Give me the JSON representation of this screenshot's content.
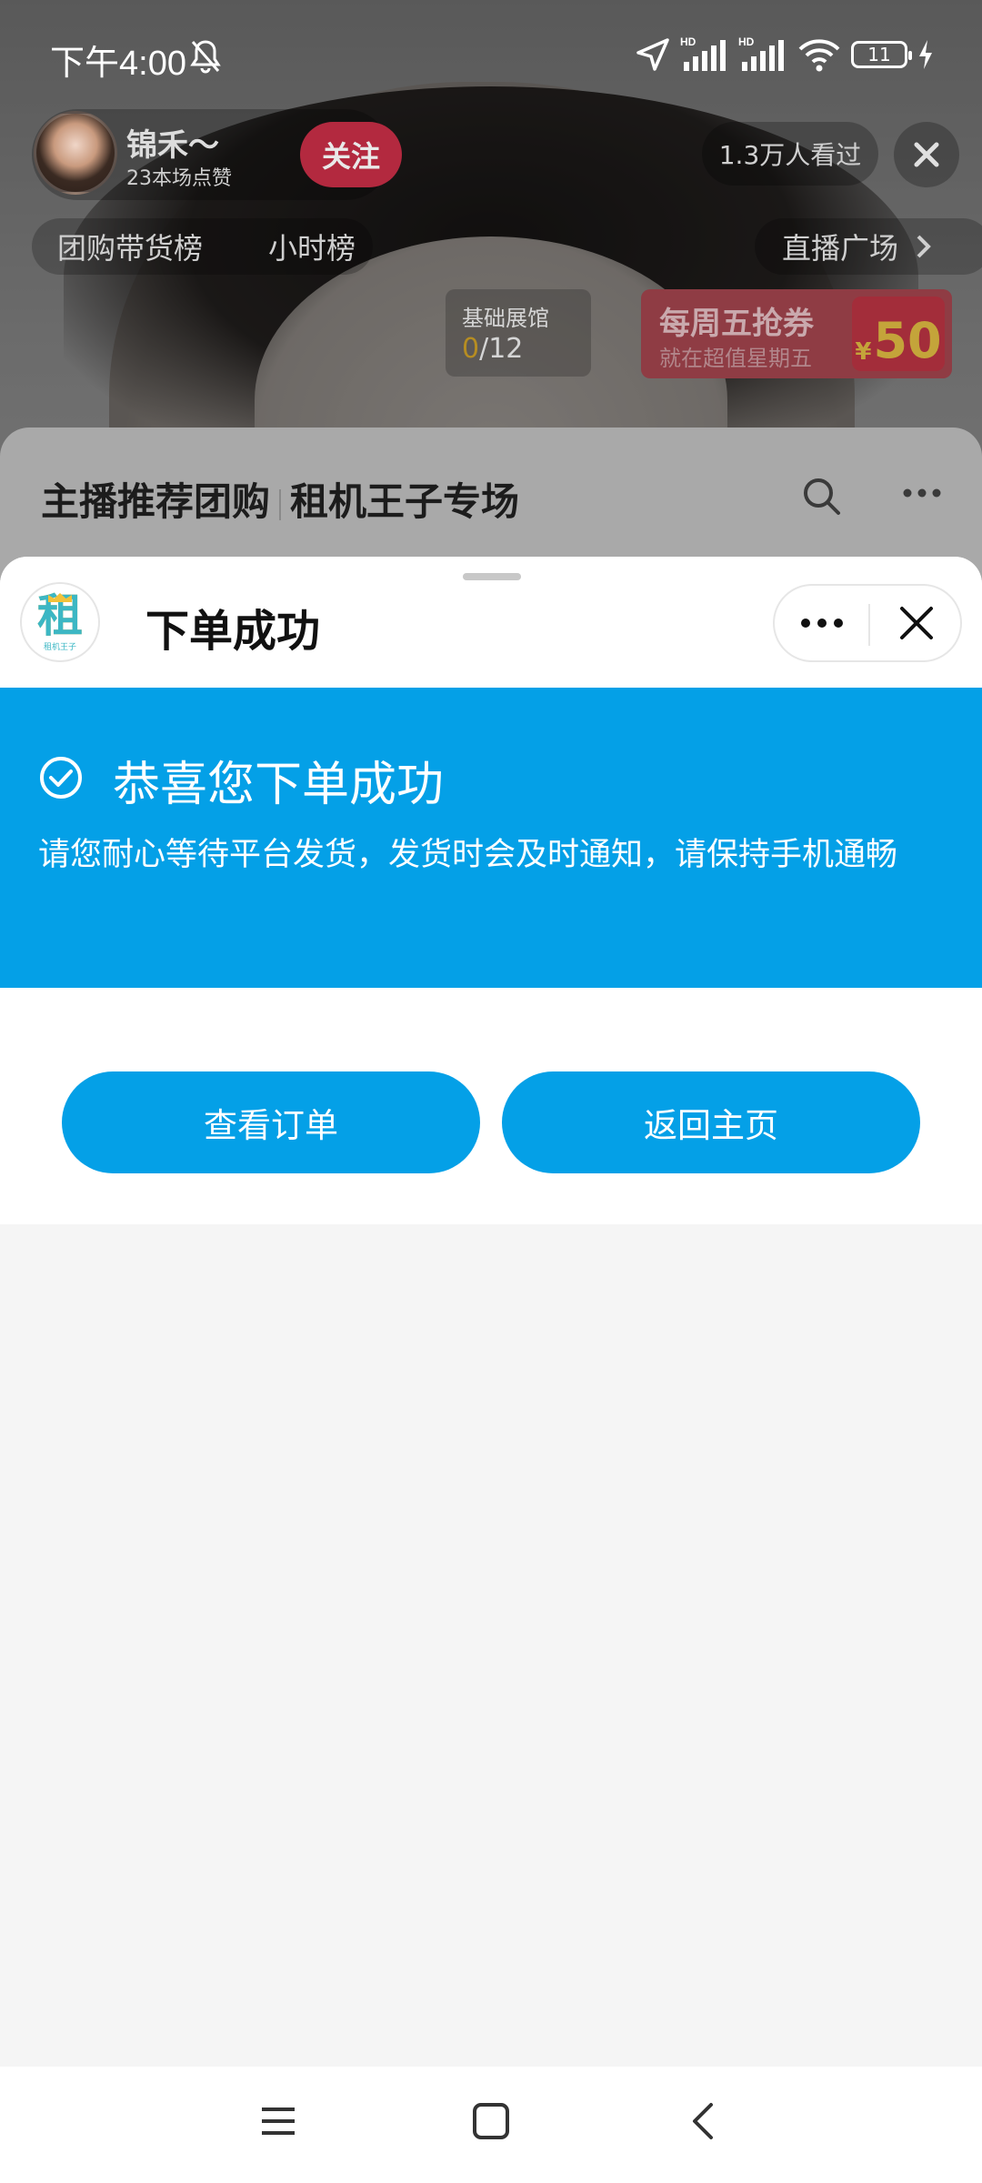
{
  "status_bar": {
    "time": "下午4:00",
    "battery": "11"
  },
  "live": {
    "host_name": "锦禾～",
    "host_likes": "23本场点赞",
    "follow_label": "关注",
    "viewers": "1.3万人看过",
    "rank_group": "团购带货榜",
    "rank_hour": "小时榜",
    "square_label": "直播广场",
    "basic_hall": {
      "title": "基础展馆",
      "current": "0",
      "total": "/12"
    },
    "coupon": {
      "title": "每周五抢券",
      "subtitle": "就在超值星期五",
      "currency": "¥",
      "amount": "50"
    }
  },
  "background_sheet": {
    "title_left": "主播推荐团购",
    "title_right": "租机王子专场"
  },
  "modal": {
    "logo_char": "租",
    "logo_sub": "租机王子",
    "title": "下单成功",
    "success_title": "恭喜您下单成功",
    "success_desc": "请您耐心等待平台发货，发货时会及时通知，请保持手机通畅",
    "view_orders_label": "查看订单",
    "back_home_label": "返回主页",
    "accent_color": "#04a0e7"
  },
  "navbar": {
    "icons": [
      "menu-icon",
      "home-square-icon",
      "back-chevron-icon"
    ]
  }
}
